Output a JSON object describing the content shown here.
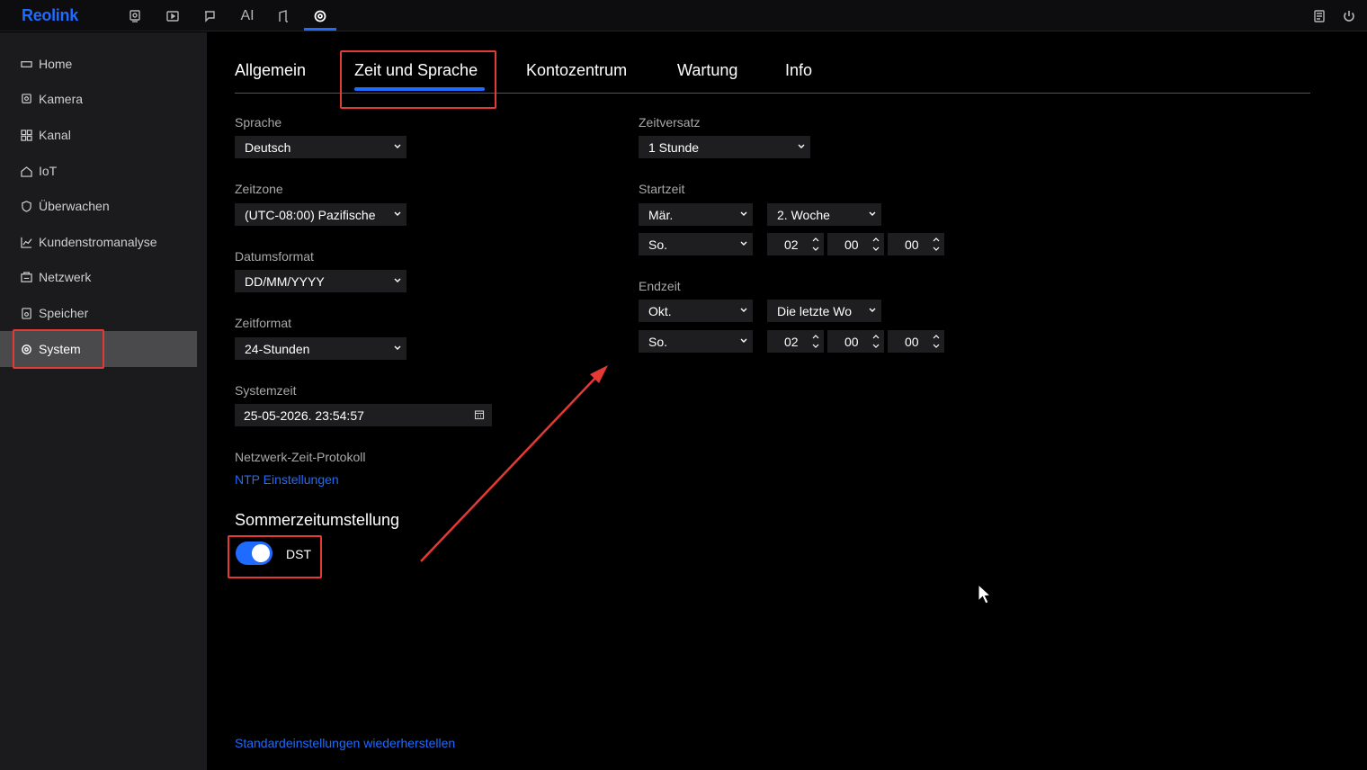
{
  "app": {
    "logo": "Reolink"
  },
  "topnav": {
    "ai_label": "AI",
    "icons": [
      "camera-icon",
      "playback-icon",
      "message-icon",
      "ai-icon",
      "device-icon",
      "settings-icon"
    ],
    "active": "settings-icon"
  },
  "sidebar": {
    "items": [
      {
        "label": "Home",
        "icon": "home-icon"
      },
      {
        "label": "Kamera",
        "icon": "camera-icon"
      },
      {
        "label": "Kanal",
        "icon": "grid-icon"
      },
      {
        "label": "IoT",
        "icon": "house-icon"
      },
      {
        "label": "Überwachen",
        "icon": "shield-icon"
      },
      {
        "label": "Kundenstromanalyse",
        "icon": "chart-icon"
      },
      {
        "label": "Netzwerk",
        "icon": "network-icon"
      },
      {
        "label": "Speicher",
        "icon": "storage-icon"
      },
      {
        "label": "System",
        "icon": "gear-icon",
        "active": true
      }
    ]
  },
  "tabs": [
    {
      "label": "Allgemein"
    },
    {
      "label": "Zeit und Sprache",
      "active": true
    },
    {
      "label": "Kontozentrum"
    },
    {
      "label": "Wartung"
    },
    {
      "label": "Info"
    }
  ],
  "left": {
    "sprache_label": "Sprache",
    "sprache_value": "Deutsch",
    "zeitzone_label": "Zeitzone",
    "zeitzone_value": "(UTC-08:00) Pazifische",
    "datumsformat_label": "Datumsformat",
    "datumsformat_value": "DD/MM/YYYY",
    "zeitformat_label": "Zeitformat",
    "zeitformat_value": "24-Stunden",
    "systemzeit_label": "Systemzeit",
    "systemzeit_value": "25-05-2026. 23:54:57",
    "ntp_label": "Netzwerk-Zeit-Protokoll",
    "ntp_link": "NTP Einstellungen"
  },
  "dst": {
    "title": "Sommerzeitumstellung",
    "toggle_label": "DST",
    "enabled": true
  },
  "right": {
    "zeitversatz_label": "Zeitversatz",
    "zeitversatz_value": "1 Stunde",
    "startzeit_label": "Startzeit",
    "start_month": "Mär.",
    "start_week": "2. Woche",
    "start_day": "So.",
    "start_hour": "02",
    "start_min": "00",
    "start_sec": "00",
    "endzeit_label": "Endzeit",
    "end_month": "Okt.",
    "end_week": "Die letzte Wo",
    "end_day": "So.",
    "end_hour": "02",
    "end_min": "00",
    "end_sec": "00"
  },
  "footer": {
    "restore_link": "Standardeinstellungen wiederherstellen"
  },
  "colors": {
    "accent": "#1f6bff",
    "highlight": "#e53935",
    "sidebar_bg": "#1b1b1d",
    "field_bg": "#1e1e20"
  }
}
